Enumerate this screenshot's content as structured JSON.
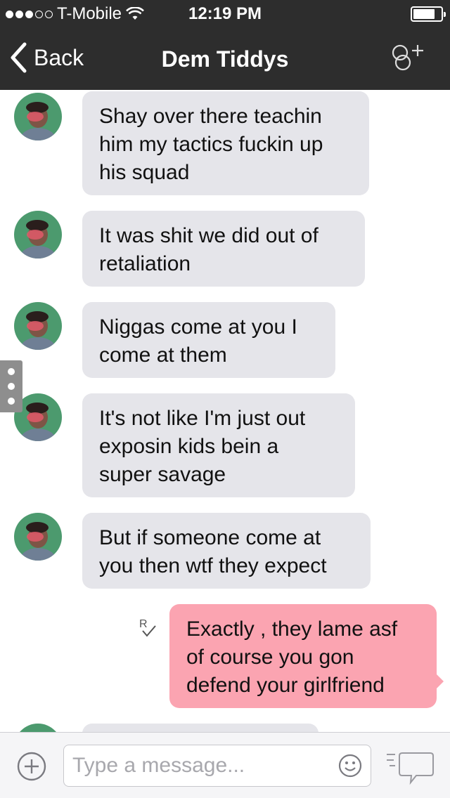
{
  "status_bar": {
    "carrier": "T-Mobile",
    "time": "12:19 PM"
  },
  "nav": {
    "back_label": "Back",
    "title": "Dem Tiddys"
  },
  "messages": [
    {
      "direction": "incoming",
      "lines": [
        "Shay over there teachin",
        "him my tactics fuckin up",
        "his squad"
      ]
    },
    {
      "direction": "incoming",
      "lines": [
        "It was shit we did out of",
        "retaliation"
      ]
    },
    {
      "direction": "incoming",
      "lines": [
        "Niggas come at you I",
        "come at them"
      ]
    },
    {
      "direction": "incoming",
      "lines": [
        "It's not like I'm just out",
        "exposin kids bein a",
        "super savage"
      ]
    },
    {
      "direction": "incoming",
      "lines": [
        "But if someone come at",
        "you then wtf they expect"
      ]
    },
    {
      "direction": "outgoing",
      "lines": [
        "Exactly , they lame asf",
        "of course you gon",
        "defend your girlfriend"
      ]
    }
  ],
  "composer": {
    "placeholder": "Type a message..."
  },
  "colors": {
    "bar": "#2d2d2d",
    "incoming_bubble": "#e5e5ea",
    "outgoing_bubble": "#fba4b1",
    "avatar_bg": "#4c9a6e"
  },
  "icons": [
    "wifi-icon",
    "battery-icon",
    "back-chevron-icon",
    "add-group-icon",
    "read-receipt-icon",
    "plus-icon",
    "smiley-icon",
    "send-bubble-icon"
  ]
}
